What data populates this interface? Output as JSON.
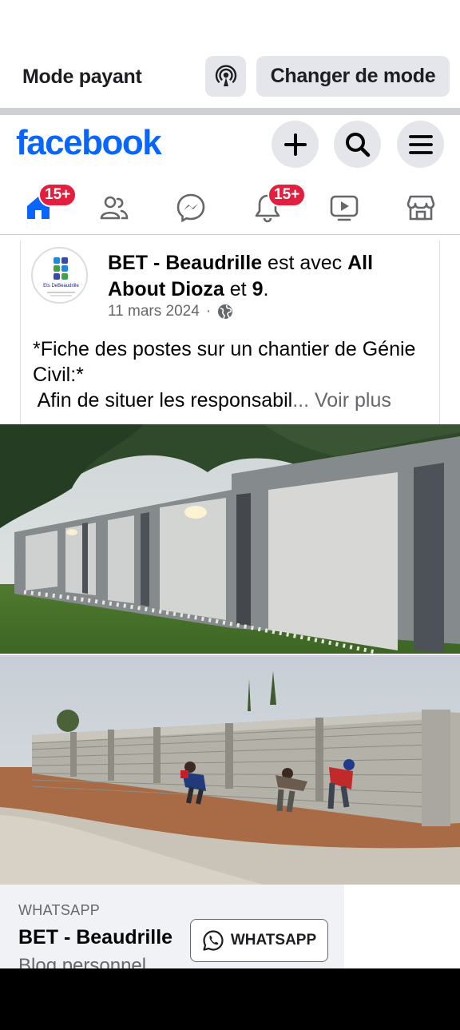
{
  "mode_bar": {
    "label": "Mode payant",
    "switch_button": "Changer de mode"
  },
  "header": {
    "logo": "facebook",
    "icons": [
      "plus-icon",
      "search-icon",
      "menu-icon"
    ]
  },
  "nav": {
    "items": [
      {
        "name": "home",
        "badge": "15+"
      },
      {
        "name": "friends",
        "badge": ""
      },
      {
        "name": "messenger",
        "badge": ""
      },
      {
        "name": "notifications",
        "badge": "15+"
      },
      {
        "name": "video",
        "badge": ""
      },
      {
        "name": "marketplace",
        "badge": ""
      }
    ]
  },
  "post": {
    "author": "BET - Beaudrille",
    "with_text": " est avec ",
    "tagged": "All About Dioza",
    "and_text": " et ",
    "others": "9",
    "period": ".",
    "date": "11 mars 2024",
    "separator": "·",
    "avatar_caption": "Ets DeBeaudrille",
    "text_line1": "*Fiche des postes sur un chantier de Génie Civil:*",
    "text_line2": " Afin de situer les responsabil",
    "more": "... Voir plus"
  },
  "ad": {
    "source": "WHATSAPP",
    "title": "BET - Beaudrille",
    "subtitle": "Blog personnel",
    "button": "WHATSAPP"
  },
  "colors": {
    "brand": "#0866ff",
    "badge": "#e41e3f",
    "button_bg": "#e4e6eb"
  }
}
